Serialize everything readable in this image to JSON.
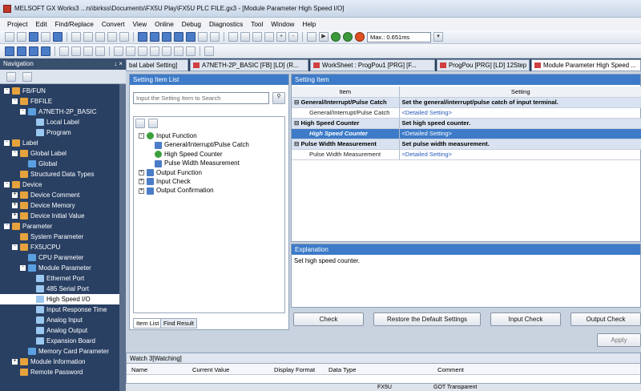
{
  "window": {
    "title": "MELSOFT GX Works3 ...rs\\birkss\\Documents\\FX5U Play\\FX5U PLC FILE.gx3 - [Module Parameter High Speed I/O]"
  },
  "menu": [
    "Project",
    "Edit",
    "Find/Replace",
    "Convert",
    "View",
    "Online",
    "Debug",
    "Diagnostics",
    "Tool",
    "Window",
    "Help"
  ],
  "toolbar": {
    "max_scan_label": "Max.: 0.651ms"
  },
  "navigation": {
    "title": "Navigation",
    "pin_label": "↓ ×",
    "items": [
      {
        "label": "FB/FUN",
        "level": 0,
        "exp": "-"
      },
      {
        "label": "FBFILE",
        "level": 1,
        "exp": "-"
      },
      {
        "label": "A7NETH-2P_BASIC",
        "level": 2,
        "exp": "-"
      },
      {
        "label": "Local Label",
        "level": 3,
        "exp": ""
      },
      {
        "label": "Program",
        "level": 3,
        "exp": ""
      },
      {
        "label": "Label",
        "level": 0,
        "exp": "-"
      },
      {
        "label": "Global Label",
        "level": 1,
        "exp": "-"
      },
      {
        "label": "Global",
        "level": 2,
        "exp": ""
      },
      {
        "label": "Structured Data Types",
        "level": 1,
        "exp": ""
      },
      {
        "label": "Device",
        "level": 0,
        "exp": "-"
      },
      {
        "label": "Device Comment",
        "level": 1,
        "exp": "+"
      },
      {
        "label": "Device Memory",
        "level": 1,
        "exp": "+"
      },
      {
        "label": "Device Initial Value",
        "level": 1,
        "exp": "+"
      },
      {
        "label": "Parameter",
        "level": 0,
        "exp": "-"
      },
      {
        "label": "System Parameter",
        "level": 1,
        "exp": ""
      },
      {
        "label": "FX5UCPU",
        "level": 1,
        "exp": "-"
      },
      {
        "label": "CPU Parameter",
        "level": 2,
        "exp": ""
      },
      {
        "label": "Module Parameter",
        "level": 2,
        "exp": "-"
      },
      {
        "label": "Ethernet Port",
        "level": 3,
        "exp": ""
      },
      {
        "label": "485 Serial Port",
        "level": 3,
        "exp": ""
      },
      {
        "label": "High Speed I/O",
        "level": 3,
        "exp": "",
        "selected": true
      },
      {
        "label": "Input Response Time",
        "level": 3,
        "exp": ""
      },
      {
        "label": "Analog Input",
        "level": 3,
        "exp": ""
      },
      {
        "label": "Analog Output",
        "level": 3,
        "exp": ""
      },
      {
        "label": "Expansion Board",
        "level": 3,
        "exp": ""
      },
      {
        "label": "Memory Card Parameter",
        "level": 2,
        "exp": ""
      },
      {
        "label": "Module Information",
        "level": 1,
        "exp": "+"
      },
      {
        "label": "Remote Password",
        "level": 1,
        "exp": ""
      }
    ]
  },
  "tabs": [
    {
      "label": "bal Label Setting]"
    },
    {
      "label": "A7NETH-2P_BASIC [FB] [LD] (R..."
    },
    {
      "label": "WorkSheet : ProgPou1 [PRG] [F..."
    },
    {
      "label": "ProgPou [PRG] [LD] 12Step"
    },
    {
      "label": "Module Parameter High Speed ..."
    }
  ],
  "setting_list": {
    "title": "Setting Item List",
    "search_placeholder": "Input the Setting Item to Search",
    "tree": [
      {
        "label": "Input Function",
        "level": 0,
        "exp": "-"
      },
      {
        "label": "General/Interrupt/Pulse Catch",
        "level": 1,
        "exp": ""
      },
      {
        "label": "High Speed Counter",
        "level": 1,
        "exp": ""
      },
      {
        "label": "Pulse Width Measurement",
        "level": 1,
        "exp": ""
      },
      {
        "label": "Output Function",
        "level": 0,
        "exp": "+"
      },
      {
        "label": "Input Check",
        "level": 0,
        "exp": "+"
      },
      {
        "label": "Output Confirmation",
        "level": 0,
        "exp": "+"
      }
    ],
    "bottom_tabs": [
      "Item List",
      "Find Result"
    ]
  },
  "setting_item": {
    "title": "Setting Item",
    "col_item": "Item",
    "col_setting": "Setting",
    "rows": [
      {
        "item": "General/Interrupt/Pulse Catch",
        "setting": "Set the general/interrupt/pulse catch of input terminal.",
        "kind": "group"
      },
      {
        "item": "General/Interrupt/Pulse Catch",
        "setting": "<Detailed Setting>",
        "kind": "child"
      },
      {
        "item": "High Speed Counter",
        "setting": "Set high speed counter.",
        "kind": "group"
      },
      {
        "item": "High Speed Counter",
        "setting": "<Detailed Setting>",
        "kind": "childsel"
      },
      {
        "item": "Pulse Width Measurement",
        "setting": "Set pulse width measurement.",
        "kind": "group"
      },
      {
        "item": "Pulse Width Measurement",
        "setting": "<Detailed Setting>",
        "kind": "child"
      }
    ]
  },
  "explanation": {
    "title": "Explanation",
    "text": "Set high speed counter."
  },
  "buttons": {
    "check": "Check",
    "restore": "Restore the Default Settings",
    "input_check": "Input Check",
    "output_check": "Output Check",
    "apply": "Apply"
  },
  "watch": {
    "title": "Watch 3[Watching]",
    "columns": [
      "Name",
      "Current Value",
      "Display Format",
      "Data Type",
      "Comment"
    ],
    "status": [
      "FX5U",
      "GOT Transparent"
    ]
  },
  "colors": {
    "nav_bg": "#294063",
    "header_blue": "#3d7bc8",
    "group_bg": "#d8e2f0",
    "sel_row": "#3d7bc8"
  }
}
